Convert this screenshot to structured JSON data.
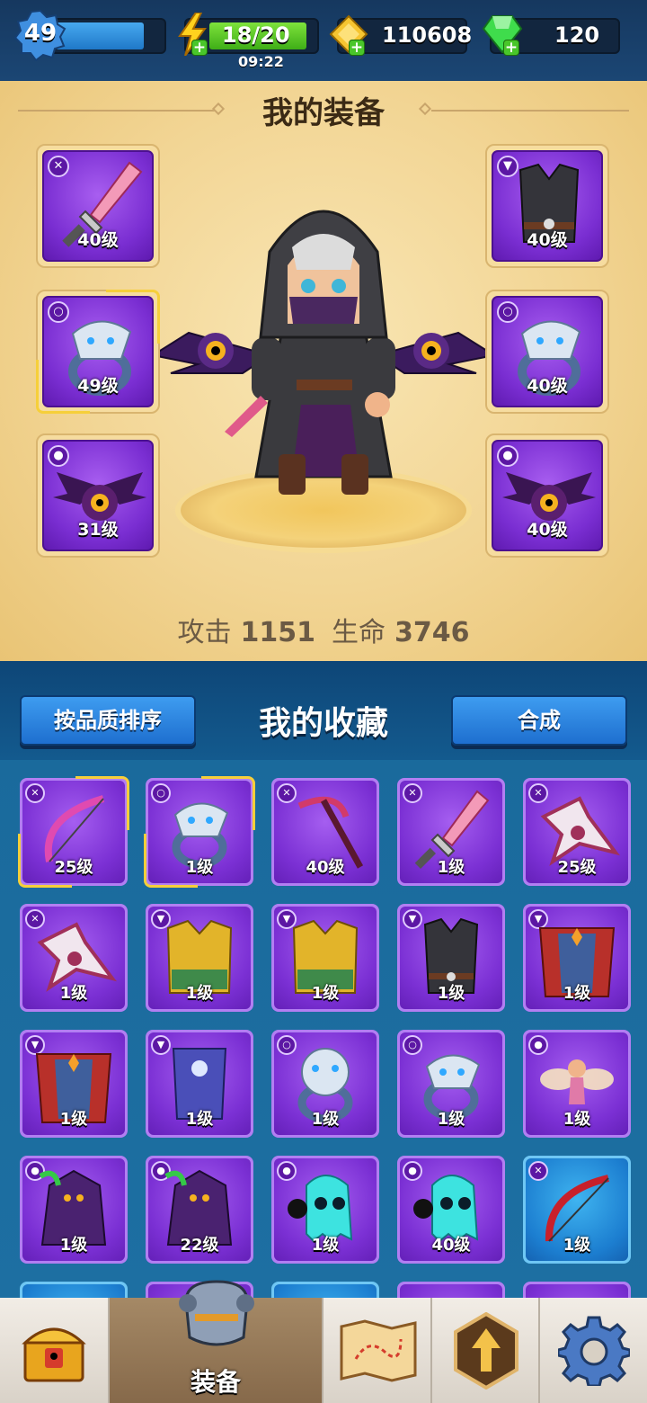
{
  "top_bar": {
    "player_level": "49",
    "energy": "18/20",
    "energy_timer": "09:22",
    "gold": "110608",
    "gems": "120"
  },
  "equipment": {
    "title": "我的装备",
    "slots": [
      {
        "type_icon": "weapon-icon",
        "level": "40级",
        "item_icon": "pink-sword-icon"
      },
      {
        "type_icon": "armor-icon",
        "level": "40级",
        "item_icon": "dark-vest-icon"
      },
      {
        "type_icon": "ring-icon",
        "level": "49级",
        "item_icon": "wolf-ring-icon"
      },
      {
        "type_icon": "ring-icon",
        "level": "40级",
        "item_icon": "wolf-ring-icon"
      },
      {
        "type_icon": "pet-icon",
        "level": "31级",
        "item_icon": "bat-pet-icon"
      },
      {
        "type_icon": "pet-icon",
        "level": "40级",
        "item_icon": "bat-pet-icon"
      }
    ],
    "attack_label": "攻击",
    "attack_value": "1151",
    "hp_label": "生命",
    "hp_value": "3746"
  },
  "collection": {
    "sort_button": "按品质排序",
    "title": "我的收藏",
    "merge_button": "合成",
    "items": [
      {
        "type_icon": "weapon-icon",
        "level": "25级",
        "item_icon": "pink-bow-icon",
        "rarity": "purple"
      },
      {
        "type_icon": "ring-icon",
        "level": "1级",
        "item_icon": "wolf-ring-icon",
        "rarity": "purple"
      },
      {
        "type_icon": "weapon-icon",
        "level": "40级",
        "item_icon": "scythe-icon",
        "rarity": "purple"
      },
      {
        "type_icon": "weapon-icon",
        "level": "1级",
        "item_icon": "pink-sword-icon",
        "rarity": "purple"
      },
      {
        "type_icon": "weapon-icon",
        "level": "25级",
        "item_icon": "shuriken-icon",
        "rarity": "purple"
      },
      {
        "type_icon": "weapon-icon",
        "level": "1级",
        "item_icon": "shuriken-icon",
        "rarity": "purple"
      },
      {
        "type_icon": "armor-icon",
        "level": "1级",
        "item_icon": "gold-armor-icon",
        "rarity": "purple"
      },
      {
        "type_icon": "armor-icon",
        "level": "1级",
        "item_icon": "gold-armor-icon",
        "rarity": "purple"
      },
      {
        "type_icon": "armor-icon",
        "level": "1级",
        "item_icon": "dark-vest-icon",
        "rarity": "purple"
      },
      {
        "type_icon": "armor-icon",
        "level": "1级",
        "item_icon": "red-cloak-icon",
        "rarity": "purple"
      },
      {
        "type_icon": "armor-icon",
        "level": "1级",
        "item_icon": "red-cloak-icon",
        "rarity": "purple"
      },
      {
        "type_icon": "armor-icon",
        "level": "1级",
        "item_icon": "blue-armor-icon",
        "rarity": "purple"
      },
      {
        "type_icon": "ring-icon",
        "level": "1级",
        "item_icon": "bear-ring-icon",
        "rarity": "purple"
      },
      {
        "type_icon": "ring-icon",
        "level": "1级",
        "item_icon": "wolf-ring-icon",
        "rarity": "purple"
      },
      {
        "type_icon": "pet-icon",
        "level": "1级",
        "item_icon": "fairy-pet-icon",
        "rarity": "purple"
      },
      {
        "type_icon": "pet-icon",
        "level": "1级",
        "item_icon": "reaper-pet-icon",
        "rarity": "purple"
      },
      {
        "type_icon": "pet-icon",
        "level": "22级",
        "item_icon": "reaper-pet-icon",
        "rarity": "purple"
      },
      {
        "type_icon": "pet-icon",
        "level": "1级",
        "item_icon": "ghost-pet-icon",
        "rarity": "purple"
      },
      {
        "type_icon": "pet-icon",
        "level": "40级",
        "item_icon": "ghost-pet-icon",
        "rarity": "purple"
      },
      {
        "type_icon": "weapon-icon",
        "level": "1级",
        "item_icon": "red-bow-icon",
        "rarity": "blue"
      }
    ]
  },
  "nav": {
    "equipment_label": "装备"
  },
  "colors": {
    "purple_rarity": "#7b30d4",
    "blue_rarity": "#1c7ed0",
    "panel_gold": "#f2d594",
    "accent_green": "#49c62a"
  }
}
